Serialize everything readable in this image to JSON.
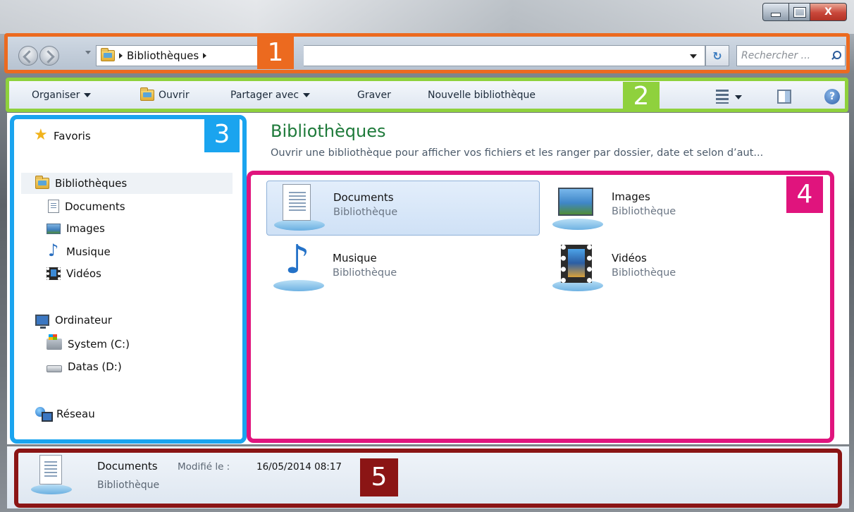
{
  "window": {
    "controls": {
      "minimize": "",
      "maximize": "",
      "close": "X"
    }
  },
  "address_bar": {
    "path": [
      "Bibliothèques"
    ],
    "search_placeholder": "Rechercher ...",
    "refresh_icon": "refresh-arrows-icon",
    "badge": "1"
  },
  "toolbar": {
    "organiser": "Organiser",
    "ouvrir": "Ouvrir",
    "partager": "Partager avec",
    "graver": "Graver",
    "nouvelle": "Nouvelle bibliothèque",
    "badge": "2"
  },
  "nav_pane": {
    "badge": "3",
    "favorites": "Favoris",
    "libraries": "Bibliothèques",
    "library_items": [
      "Documents",
      "Images",
      "Musique",
      "Vidéos"
    ],
    "computer": "Ordinateur",
    "drives": [
      "System (C:)",
      "Datas (D:)"
    ],
    "network": "Réseau"
  },
  "content": {
    "title": "Bibliothèques",
    "subtitle": "Ouvrir une bibliothèque pour afficher vos fichiers et les ranger par dossier, date et selon d’aut...",
    "badge": "4",
    "libraries": [
      {
        "name": "Documents",
        "type": "Bibliothèque",
        "icon": "documents-library-icon",
        "selected": true
      },
      {
        "name": "Images",
        "type": "Bibliothèque",
        "icon": "images-library-icon",
        "selected": false
      },
      {
        "name": "Musique",
        "type": "Bibliothèque",
        "icon": "music-library-icon",
        "selected": false
      },
      {
        "name": "Vidéos",
        "type": "Bibliothèque",
        "icon": "videos-library-icon",
        "selected": false
      }
    ]
  },
  "details": {
    "badge": "5",
    "name": "Documents",
    "modified_label": "Modifié le :",
    "modified_value": "16/05/2014 08:17",
    "type": "Bibliothèque"
  },
  "colors": {
    "zone1": "#ec6a1f",
    "zone2": "#8fd13d",
    "zone3": "#1aa4ef",
    "zone4": "#e0147d",
    "zone5": "#8b1515",
    "title_green": "#1e7a3a"
  }
}
